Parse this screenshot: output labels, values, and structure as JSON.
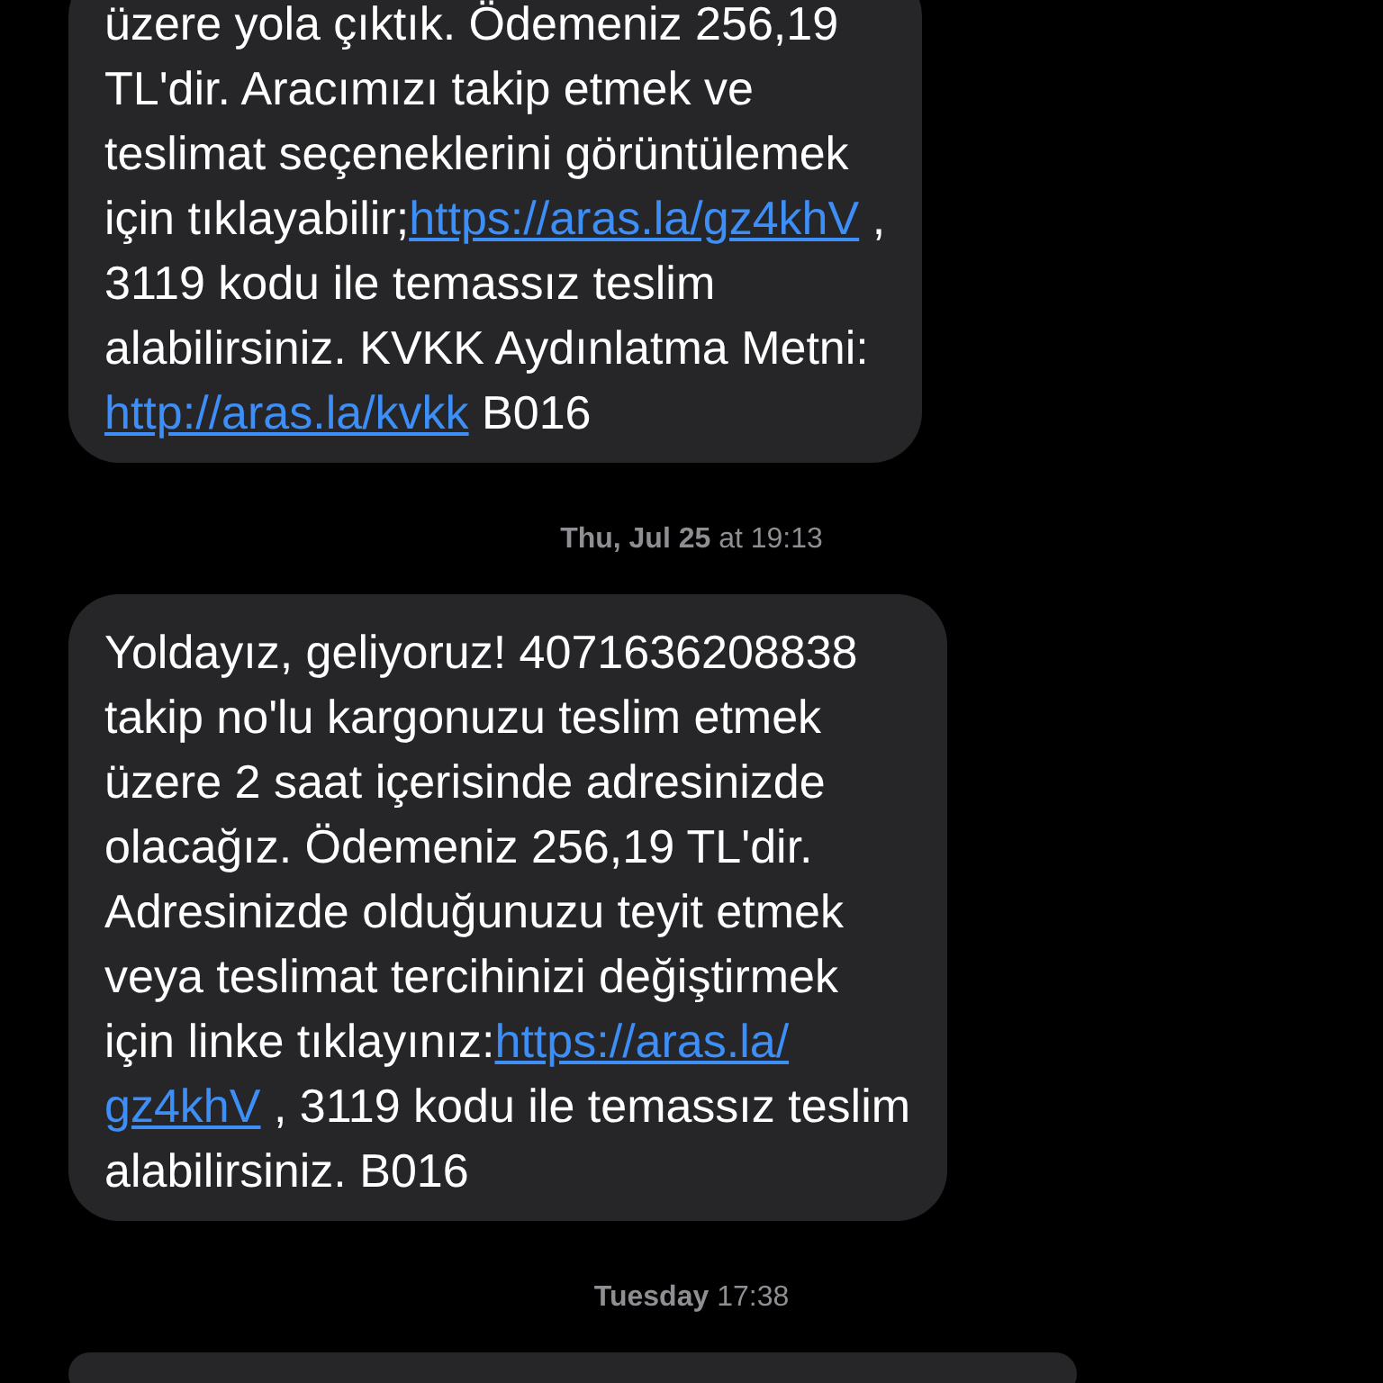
{
  "thread": [
    {
      "kind": "message",
      "lines": [
        [
          {
            "text": "üzere yola çıktık. Ödemeniz 256,19",
            "link": false
          }
        ],
        [
          {
            "text": "TL'dir. Aracımızı takip etmek ve",
            "link": false
          }
        ],
        [
          {
            "text": "teslimat seçeneklerini görüntülemek",
            "link": false
          }
        ],
        [
          {
            "text": "için tıklayabilir;",
            "link": false
          },
          {
            "text": "https://aras.la/gz4khV",
            "link": true
          },
          {
            "text": " ,",
            "link": false
          }
        ],
        [
          {
            "text": "3119 kodu ile temassız teslim",
            "link": false
          }
        ],
        [
          {
            "text": "alabilirsiniz. KVKK Aydınlatma Metni:",
            "link": false
          }
        ],
        [
          {
            "text": "http://aras.la/kvkk",
            "link": true
          },
          {
            "text": " B016",
            "link": false
          }
        ]
      ]
    },
    {
      "kind": "timestamp",
      "text": "**Thu, Jul 25** at 19:13"
    },
    {
      "kind": "message",
      "lines": [
        [
          {
            "text": "Yoldayız, geliyoruz! 4071636208838",
            "link": false
          }
        ],
        [
          {
            "text": "takip no'lu kargonuzu teslim etmek",
            "link": false
          }
        ],
        [
          {
            "text": "üzere 2 saat içerisinde adresinizde",
            "link": false
          }
        ],
        [
          {
            "text": "olacağız. Ödemeniz 256,19 TL'dir.",
            "link": false
          }
        ],
        [
          {
            "text": "Adresinizde olduğunuzu teyit etmek",
            "link": false
          }
        ],
        [
          {
            "text": "veya teslimat tercihinizi değiştirmek",
            "link": false
          }
        ],
        [
          {
            "text": "için linke tıklayınız:",
            "link": false
          },
          {
            "text": "https://aras.la/",
            "link": true
          }
        ],
        [
          {
            "text": "gz4khV",
            "link": true
          },
          {
            "text": " , 3119 kodu ile temassız teslim",
            "link": false
          }
        ],
        [
          {
            "text": "alabilirsiniz. B016",
            "link": false
          }
        ]
      ]
    },
    {
      "kind": "timestamp",
      "text": "**Tuesday** 17:38"
    },
    {
      "kind": "message"
    }
  ]
}
